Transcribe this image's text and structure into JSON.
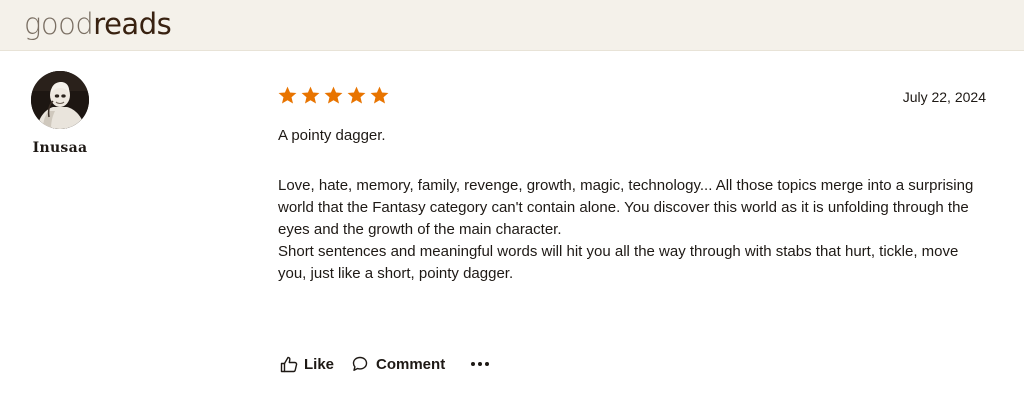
{
  "header": {
    "logo_good": "good",
    "logo_reads": "reads"
  },
  "reviewer": {
    "name": "Inusaa",
    "avatar_icon": "user-avatar-photo"
  },
  "review": {
    "rating": 5,
    "rating_max": 5,
    "star_color": "#e87400",
    "date": "July 22, 2024",
    "title": "A pointy dagger.",
    "paragraphs": [
      "Love, hate, memory, family, revenge, growth, magic, technology... All those topics merge into a surprising world that the Fantasy category can't contain alone. You discover this world as it is unfolding through the eyes and the growth of the main character.",
      "Short sentences and meaningful words will hit you all the way through with stabs that hurt, tickle, move you, just like a short, pointy dagger."
    ]
  },
  "actions": {
    "like_label": "Like",
    "like_icon": "thumbs-up-icon",
    "comment_label": "Comment",
    "comment_icon": "comment-bubble-icon",
    "more_icon": "more-options-icon"
  }
}
